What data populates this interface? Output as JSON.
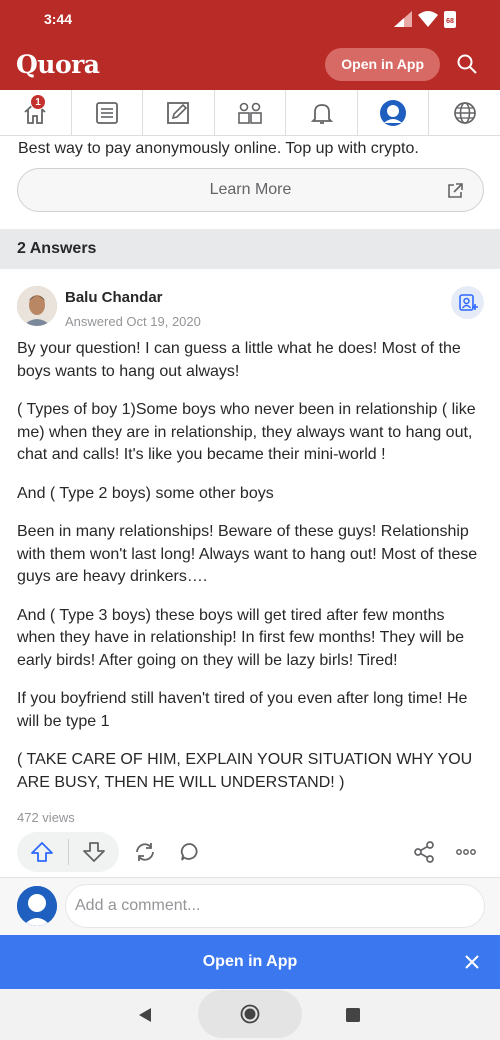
{
  "status_bar": {
    "time": "3:44",
    "battery": "68"
  },
  "header": {
    "logo": "Quora",
    "open_app_label": "Open in App"
  },
  "nav": {
    "notification_count": "1",
    "items": [
      "home-icon",
      "answer-list-icon",
      "edit-icon",
      "spaces-icon",
      "bell-icon",
      "profile-icon",
      "globe-icon"
    ]
  },
  "ad": {
    "text": "Best way to pay anonymously online. Top up with crypto.",
    "cta_label": "Learn More"
  },
  "answers_header": "2 Answers",
  "answer": {
    "author": "Balu Chandar",
    "date": "Answered Oct 19, 2020",
    "paragraphs": [
      "By your question! I can guess a little what he does! Most of the boys wants to hang out always!",
      "( Types of boy 1)Some boys who never been in relationship ( like me) when they are in relationship, they always want to hang out, chat and calls! It's like you became their mini-world !",
      "And ( Type 2 boys) some other boys",
      "Been in many relationships! Beware of these guys! Relationship with them won't last long! Always want to hang out! Most of these guys are heavy drinkers….",
      "And ( Type 3 boys) these boys will get tired after few months when they have in relationship! In first few months! They will be early birds! After going on they will be lazy birls! Tired!",
      "If you boyfriend still haven't tired of you even after long time! He will be type 1",
      "( TAKE CARE OF HIM, EXPLAIN YOUR SITUATION WHY YOU ARE BUSY, THEN HE WILL UNDERSTAND! )"
    ],
    "views": "472 views"
  },
  "comment": {
    "placeholder": "Add a comment..."
  },
  "banner": {
    "label": "Open in App"
  },
  "colors": {
    "brand": "#b92b27",
    "banner": "#3b78f0",
    "link": "#2e69ff"
  }
}
